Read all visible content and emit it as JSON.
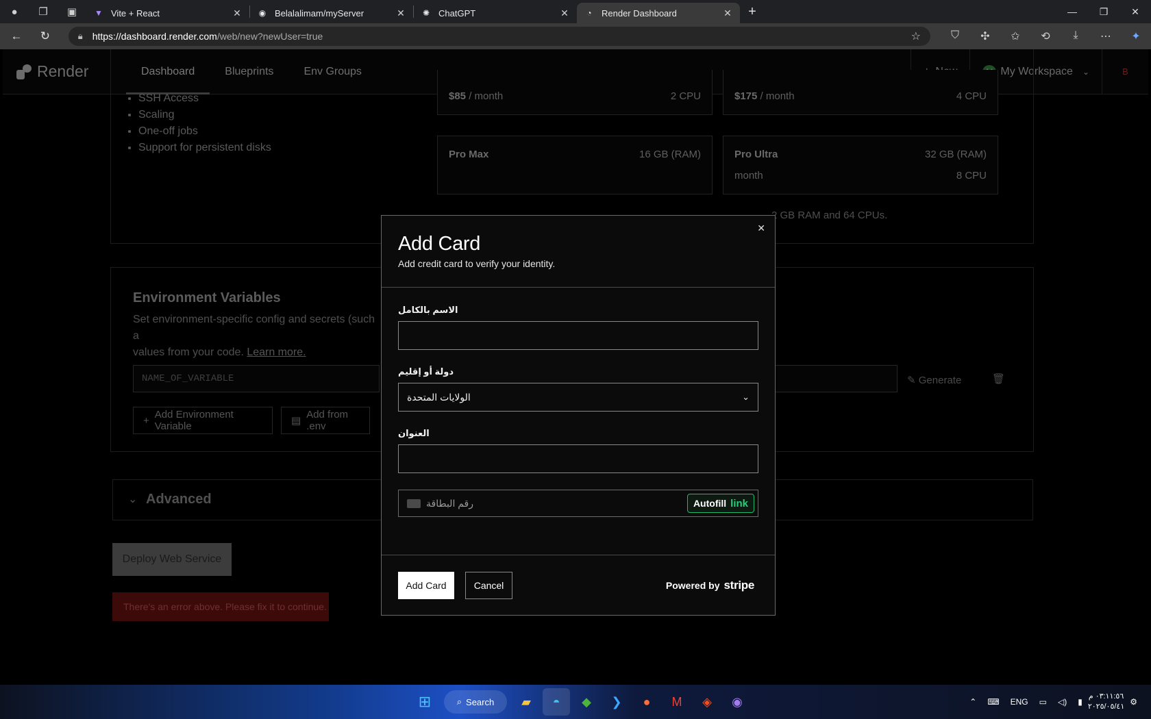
{
  "browser": {
    "tabs": [
      {
        "title": "Vite + React",
        "icon": "vite-icon"
      },
      {
        "title": "Belalalimam/myServer",
        "icon": "github-icon"
      },
      {
        "title": "ChatGPT",
        "icon": "chatgpt-icon"
      },
      {
        "title": "Render Dashboard",
        "icon": "render-icon",
        "active": true
      }
    ],
    "url_host": "https://dashboard.render.com",
    "url_path": "/web/new?newUser=true"
  },
  "render_nav": {
    "brand": "Render",
    "links": [
      "Dashboard",
      "Blueprints",
      "Env Groups"
    ],
    "new_label": "New",
    "workspace_initial": "M",
    "workspace_label": "My Workspace",
    "user_initial": "B"
  },
  "background": {
    "features": [
      "SSH Access",
      "Scaling",
      "One-off jobs",
      "Support for persistent disks"
    ],
    "plans": [
      {
        "name": "",
        "price": "$85",
        "period": " / month",
        "spec1": "",
        "spec2": "2 CPU"
      },
      {
        "name": "",
        "price": "$175",
        "period": " / month",
        "spec1": "",
        "spec2": "4 CPU"
      },
      {
        "name": "Pro Max",
        "price": "",
        "period": "",
        "spec1": "16 GB (RAM)",
        "spec2": ""
      },
      {
        "name": "Pro Ultra",
        "price": "",
        "period": "month",
        "spec1": "32 GB (RAM)",
        "spec2": "8 CPU"
      }
    ],
    "plans_note": "2 GB RAM and 64 CPUs.",
    "env_title": "Environment Variables",
    "env_desc": "Set environment-specific config and secrets (such a",
    "env_desc2": "values from your code.",
    "learn_more": "Learn more.",
    "var_placeholder": "NAME_OF_VARIABLE",
    "generate_label": "Generate",
    "add_env_label": "Add Environment Variable",
    "add_from_env_label": "Add from .env",
    "advanced_label": "Advanced",
    "deploy_label": "Deploy Web Service",
    "error_text": "There's an error above. Please fix it to continue."
  },
  "modal": {
    "title": "Add Card",
    "subtitle": "Add credit card to verify your identity.",
    "close_icon": "close-icon",
    "full_name_label": "الاسم بالكامل",
    "full_name_value": "",
    "country_label": "دولة أو إقليم",
    "country_value": "الولايات المتحدة",
    "address_label": "العنوان",
    "address_value": "",
    "card_placeholder": "رقم البطاقة",
    "autofill_label": "Autofill",
    "autofill_link": "link",
    "add_card_button": "Add Card",
    "cancel_button": "Cancel",
    "powered_by": "Powered by",
    "stripe": "stripe"
  },
  "taskbar": {
    "search_label": "Search",
    "lang": "ENG",
    "time": "٠٣:١١:٥٦ م",
    "date": "٢٠٢٥/٠٥/٤١"
  }
}
